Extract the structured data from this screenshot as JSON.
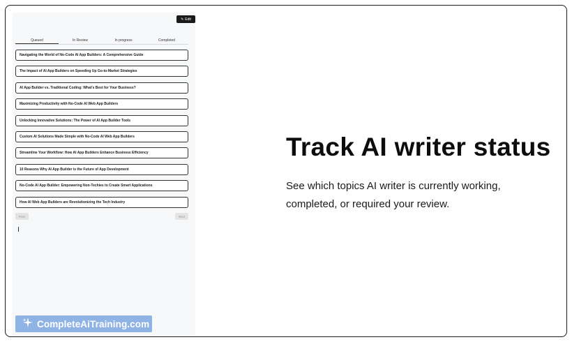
{
  "panel": {
    "edit_label": "Edit",
    "edit_icon": "pencil-square-icon",
    "tabs": [
      {
        "label": "Queued"
      },
      {
        "label": "In Review"
      },
      {
        "label": "In progress"
      },
      {
        "label": "Completed"
      }
    ],
    "active_tab": "Queued",
    "items": [
      "Navigating the World of No-Code AI App Builders: A Comprehensive Guide",
      "The Impact of AI App Builders on Speeding Up Go-to-Market Strategies",
      "AI App Builder vs. Traditional Coding: What's Best for Your Business?",
      "Maximizing Productivity with No-Code AI Web App Builders",
      "Unlocking Innovative Solutions: The Power of AI App Builder Tools",
      "Custom AI Solutions Made Simple with No-Code AI Web App Builders",
      "Streamline Your Workflow: How AI App Builders Enhance Business Efficiency",
      "10 Reasons Why AI App Builder is the Future of App Development",
      "No-Code AI App Builder: Empowering Non-Techies to Create Smart Applications",
      "How AI Web App Builders are Revolutionizing the Tech Industry"
    ],
    "prev_label": "Prev",
    "next_label": "Next"
  },
  "brand": {
    "text": "CompleteAiTraining.com",
    "icon": "sparkle-logo-icon",
    "color": "#8fb3e4"
  },
  "main": {
    "headline": "Track AI writer status",
    "description": "See which topics AI writer is currently working, completed, or required your review."
  }
}
